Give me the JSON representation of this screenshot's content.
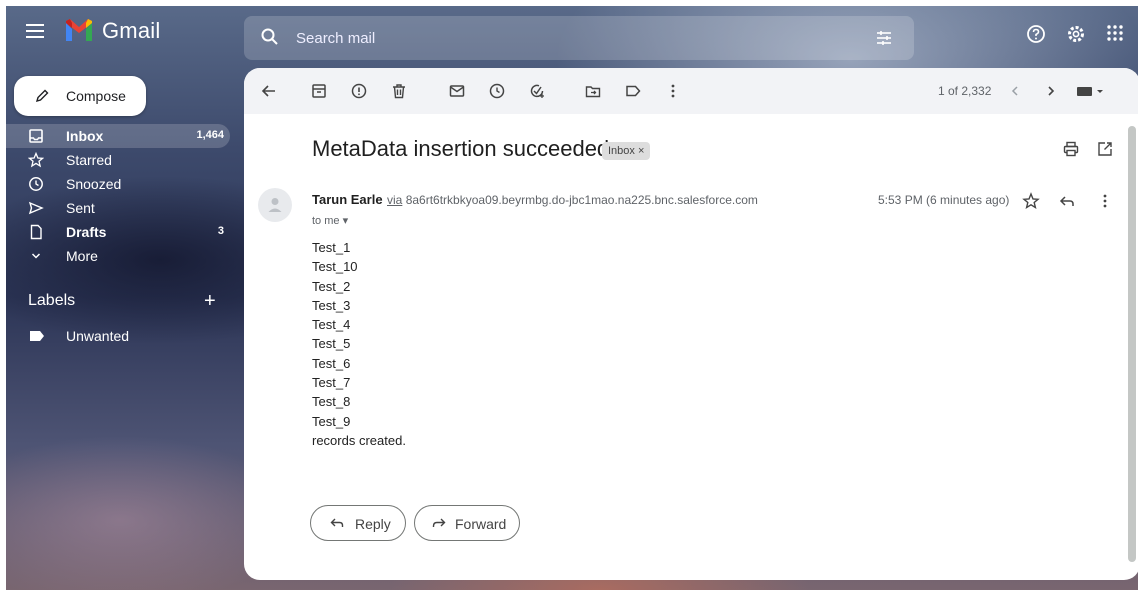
{
  "app": {
    "name": "Gmail"
  },
  "search": {
    "placeholder": "Search mail"
  },
  "sidebar": {
    "compose_label": "Compose",
    "items": [
      {
        "label": "Inbox",
        "count": "1,464"
      },
      {
        "label": "Starred",
        "count": ""
      },
      {
        "label": "Snoozed",
        "count": ""
      },
      {
        "label": "Sent",
        "count": ""
      },
      {
        "label": "Drafts",
        "count": "3"
      },
      {
        "label": "More",
        "count": ""
      }
    ],
    "labels_header": "Labels",
    "labels": [
      {
        "label": "Unwanted"
      }
    ]
  },
  "toolbar": {
    "pagination": "1 of 2,332"
  },
  "email": {
    "subject": "MetaData insertion succeeded",
    "badge": "Inbox ×",
    "sender": "Tarun Earle",
    "via_prefix": "via",
    "via_domain": "8a6rt6trkbkyoa09.beyrmbg.do-jbc1mao.na225.bnc.salesforce.com",
    "to": "to me ▾",
    "time": "5:53 PM (6 minutes ago)",
    "body": [
      "Test_1",
      "Test_10",
      "Test_2",
      "Test_3",
      "Test_4",
      "Test_5",
      "Test_6",
      "Test_7",
      "Test_8",
      "Test_9",
      "records created."
    ]
  },
  "actions": {
    "reply": "Reply",
    "forward": "Forward"
  },
  "icons": [
    "menu-icon",
    "gmail-logo-icon",
    "search-icon",
    "filter-icon",
    "help-icon",
    "settings-icon",
    "apps-icon",
    "pen-icon",
    "inbox-icon",
    "star-icon",
    "clock-icon",
    "send-icon",
    "draft-icon",
    "chevron-down-icon",
    "label-icon",
    "back-arrow-icon",
    "archive-icon",
    "report-icon",
    "trash-icon",
    "mail-icon",
    "snooze-icon",
    "task-icon",
    "move-icon",
    "tag-icon",
    "more-vert-icon",
    "chevron-left-icon",
    "chevron-right-icon",
    "keyboard-icon",
    "print-icon",
    "open-new-icon",
    "avatar-icon",
    "reply-icon",
    "forward-icon"
  ],
  "colors": {
    "panel": "#ffffff",
    "toolbar": "#f2f3f6",
    "text": "#202124",
    "muted": "#5f6368"
  }
}
